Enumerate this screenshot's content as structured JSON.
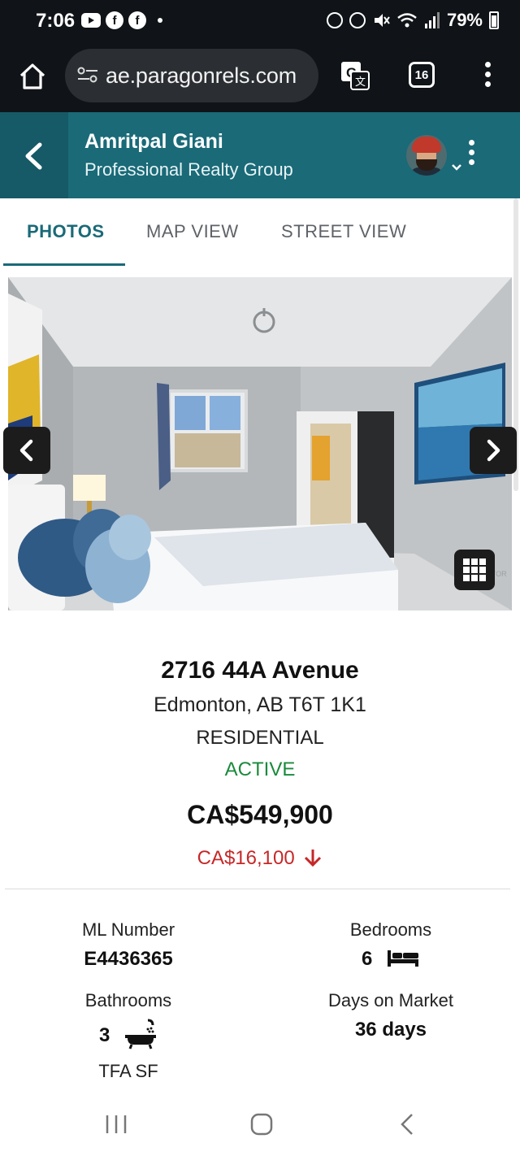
{
  "status_bar": {
    "time": "7:06",
    "battery": "79%",
    "left_icons": [
      "youtube-icon",
      "facebook-icon",
      "facebook-icon",
      "dot-icon"
    ],
    "right_icons": [
      "data-saver-icon",
      "alarm-icon",
      "mute-icon",
      "wifi-icon",
      "signal-icon",
      "battery-icon"
    ]
  },
  "browser": {
    "url": "ae.paragonrels.com",
    "tab_count": "16"
  },
  "header": {
    "agent_name": "Amritpal Giani",
    "company": "Professional Realty Group"
  },
  "tabs": [
    {
      "label": "PHOTOS",
      "active": true
    },
    {
      "label": "MAP VIEW",
      "active": false
    },
    {
      "label": "STREET VIEW",
      "active": false
    }
  ],
  "listing": {
    "address": "2716 44A Avenue",
    "city_line": "Edmonton, AB T6T 1K1",
    "property_type": "RESIDENTIAL",
    "status": "ACTIVE",
    "price": "CA$549,900",
    "price_change": "CA$16,100",
    "price_change_direction": "down"
  },
  "stats": {
    "ml_number_label": "ML Number",
    "ml_number": "E4436365",
    "bedrooms_label": "Bedrooms",
    "bedrooms": "6",
    "bathrooms_label": "Bathrooms",
    "bathrooms": "3",
    "days_label": "Days on Market",
    "days": "36 days",
    "tfa_label": "TFA SF"
  },
  "colors": {
    "header_teal": "#1a6a78",
    "status_green": "#1a8a3c",
    "price_drop_red": "#c62828"
  }
}
